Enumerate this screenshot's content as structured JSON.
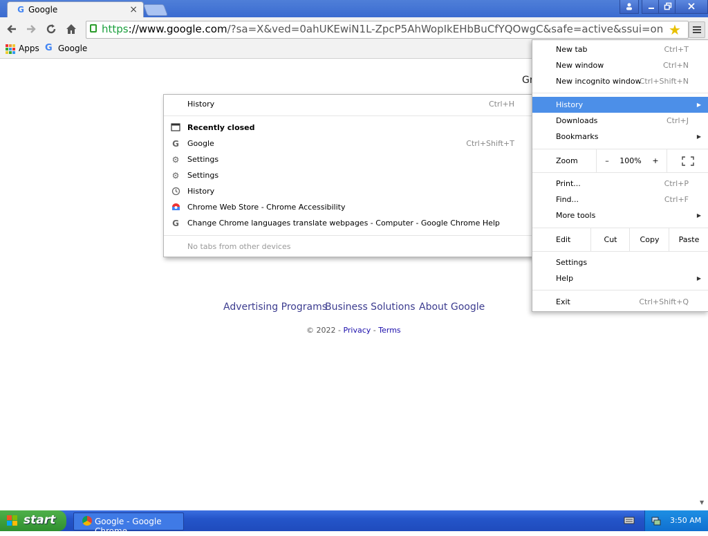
{
  "tab": {
    "title": "Google",
    "favicon": "google-g-icon",
    "close": "×"
  },
  "window_controls": {
    "profile": "profile-icon",
    "minimize": "minimize-icon",
    "restore": "restore-icon",
    "close": "close-icon"
  },
  "omnibox": {
    "scheme": "https",
    "host": "://www.google.com",
    "path": "/?sa=X&ved=0ahUKEwiN1L-ZpcP5AhWopIkEHbBuCfYQOwgC&safe=active&ssui=on"
  },
  "bookmarks": [
    {
      "label": "Apps",
      "icon": "apps-grid-icon"
    },
    {
      "label": "Google",
      "icon": "google-g-icon"
    }
  ],
  "page": {
    "partial_text": "Gr",
    "footer_links": [
      "Advertising Programs",
      "Business Solutions",
      "About Google"
    ],
    "copyright_prefix": "© 2022 - ",
    "privacy": "Privacy",
    "separator": " - ",
    "terms": "Terms"
  },
  "history_submenu": {
    "history": {
      "label": "History",
      "shortcut": "Ctrl+H"
    },
    "recently_closed": "Recently closed",
    "items": [
      {
        "label": "Google",
        "shortcut": "Ctrl+Shift+T",
        "icon": "google-g-icon"
      },
      {
        "label": "Settings",
        "shortcut": "",
        "icon": "gear-icon"
      },
      {
        "label": "Settings",
        "shortcut": "",
        "icon": "gear-icon"
      },
      {
        "label": "History",
        "shortcut": "",
        "icon": "history-clock-icon"
      },
      {
        "label": "Chrome Web Store - Chrome Accessibility",
        "shortcut": "",
        "icon": "webstore-icon"
      },
      {
        "label": "Change Chrome languages  translate webpages - Computer - Google Chrome Help",
        "shortcut": "",
        "icon": "google-g-icon"
      }
    ],
    "no_tabs": "No tabs from other devices"
  },
  "chrome_menu": {
    "new_tab": {
      "label": "New tab",
      "shortcut": "Ctrl+T"
    },
    "new_window": {
      "label": "New window",
      "shortcut": "Ctrl+N"
    },
    "new_incognito": {
      "label": "New incognito window",
      "shortcut": "Ctrl+Shift+N"
    },
    "history": {
      "label": "History"
    },
    "downloads": {
      "label": "Downloads",
      "shortcut": "Ctrl+J"
    },
    "bookmarks": {
      "label": "Bookmarks"
    },
    "zoom": {
      "label": "Zoom",
      "minus": "–",
      "value": "100%",
      "plus": "+"
    },
    "print": {
      "label": "Print...",
      "shortcut": "Ctrl+P"
    },
    "find": {
      "label": "Find...",
      "shortcut": "Ctrl+F"
    },
    "more_tools": {
      "label": "More tools"
    },
    "edit": {
      "label": "Edit",
      "cut": "Cut",
      "copy": "Copy",
      "paste": "Paste"
    },
    "settings": {
      "label": "Settings"
    },
    "help": {
      "label": "Help"
    },
    "exit": {
      "label": "Exit",
      "shortcut": "Ctrl+Shift+Q"
    }
  },
  "taskbar": {
    "start": "start",
    "task": "Google - Google Chrome",
    "clock": "3:50 AM"
  },
  "colors": {
    "highlight": "#4c8fe8",
    "taskbar": "#2455c9",
    "start": "#3a9a36"
  }
}
